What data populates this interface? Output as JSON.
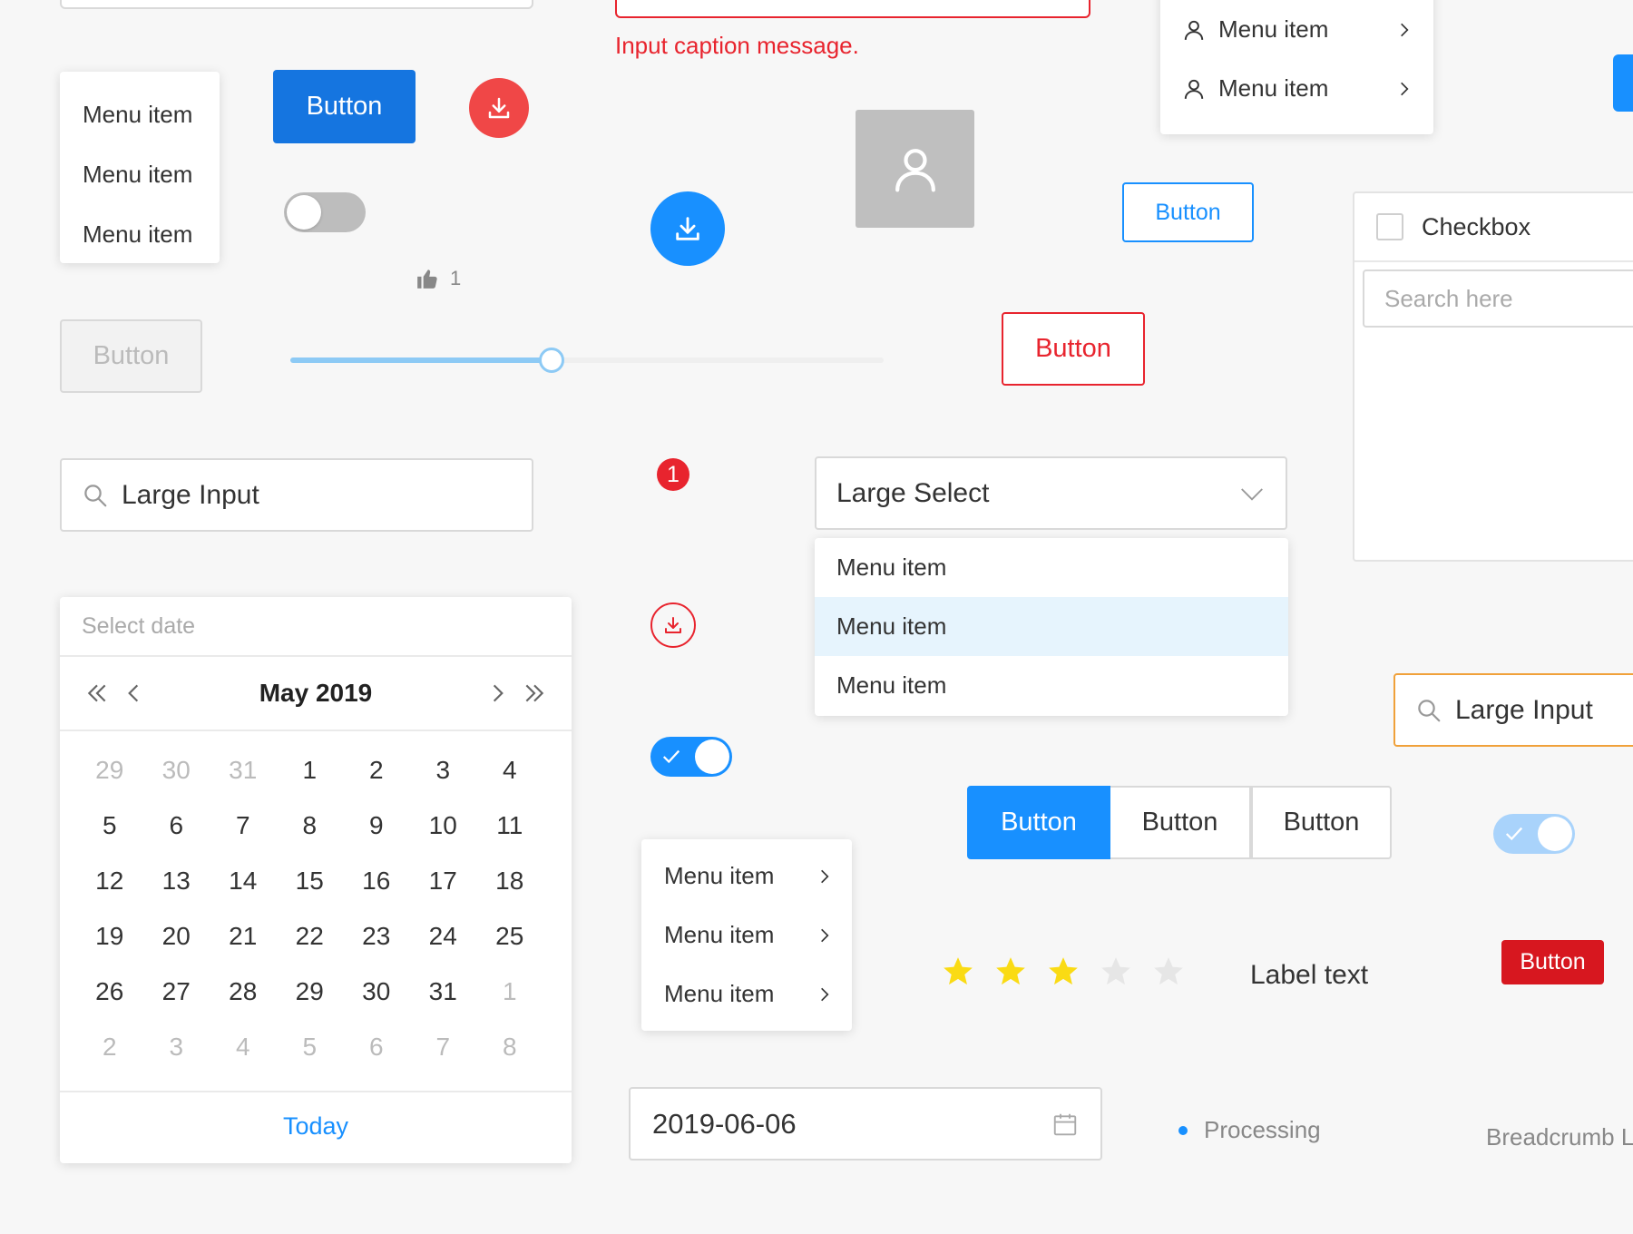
{
  "error_field": {
    "caption": "Input caption message."
  },
  "menu_small": {
    "items": [
      "Menu item",
      "Menu item",
      "Menu item"
    ]
  },
  "buttons": {
    "primary": "Button",
    "disabled": "Button",
    "danger_outline": "Button",
    "primary_outline": "Button",
    "danger_solid": "Button",
    "group": [
      "Button",
      "Button",
      "Button"
    ]
  },
  "like": {
    "count": "1"
  },
  "slider": {
    "value_fraction": 0.44
  },
  "user_menu": {
    "items": [
      "Menu item",
      "Menu item"
    ]
  },
  "checkbox_panel": {
    "checkbox_label": "Checkbox",
    "search_placeholder": "Search here"
  },
  "large_input": {
    "value": "Large Input"
  },
  "large_input_focused": {
    "value": "Large Input"
  },
  "badge": {
    "count": "1"
  },
  "large_select": {
    "value": "Large Select",
    "options": [
      "Menu item",
      "Menu item",
      "Menu item"
    ],
    "highlighted_index": 1
  },
  "datepicker": {
    "placeholder": "Select date",
    "month_label": "May 2019",
    "today_label": "Today",
    "weeks": [
      [
        "29",
        "30",
        "31",
        "1",
        "2",
        "3",
        "4"
      ],
      [
        "5",
        "6",
        "7",
        "8",
        "9",
        "10",
        "11"
      ],
      [
        "12",
        "13",
        "14",
        "15",
        "16",
        "17",
        "18"
      ],
      [
        "19",
        "20",
        "21",
        "22",
        "23",
        "24",
        "25"
      ],
      [
        "26",
        "27",
        "28",
        "29",
        "30",
        "31",
        "1"
      ],
      [
        "2",
        "3",
        "4",
        "5",
        "6",
        "7",
        "8"
      ]
    ],
    "muted": [
      [
        0,
        0
      ],
      [
        0,
        1
      ],
      [
        0,
        2
      ],
      [
        4,
        6
      ],
      [
        5,
        0
      ],
      [
        5,
        1
      ],
      [
        5,
        2
      ],
      [
        5,
        3
      ],
      [
        5,
        4
      ],
      [
        5,
        5
      ],
      [
        5,
        6
      ]
    ]
  },
  "sub_menu": {
    "items": [
      "Menu item",
      "Menu item",
      "Menu item"
    ]
  },
  "rating": {
    "value": 3,
    "max": 5,
    "label": "Label text"
  },
  "date_input": {
    "value": "2019-06-06"
  },
  "status": {
    "text": "Processing"
  },
  "breadcrumb": {
    "text": "Breadcrumb L"
  },
  "colors": {
    "primary": "#1890ff",
    "danger": "#e8242e",
    "warning": "#f0a13a",
    "star": "#fadb14"
  }
}
